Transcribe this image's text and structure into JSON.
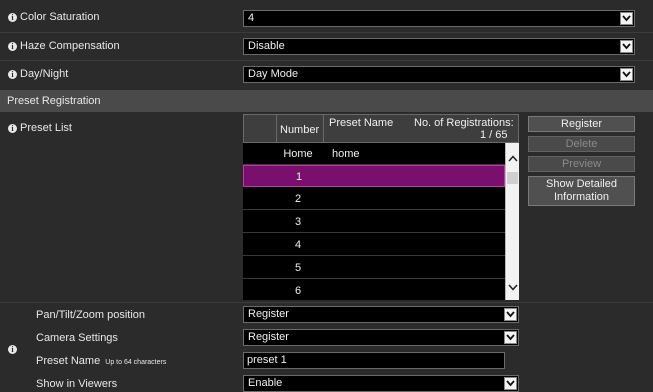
{
  "settings": {
    "color_saturation": {
      "label": "Color Saturation",
      "value": "4"
    },
    "haze_compensation": {
      "label": "Haze Compensation",
      "value": "Disable"
    },
    "day_night": {
      "label": "Day/Night",
      "value": "Day Mode"
    }
  },
  "section_title": "Preset Registration",
  "preset_list": {
    "label": "Preset List",
    "columns": {
      "number": "Number",
      "preset_name": "Preset Name",
      "registrations": "No. of Registrations:",
      "registrations_count": "1 / 65"
    },
    "rows": [
      {
        "number": "Home",
        "name": "home",
        "selected": false
      },
      {
        "number": "1",
        "name": "",
        "selected": true
      },
      {
        "number": "2",
        "name": "",
        "selected": false
      },
      {
        "number": "3",
        "name": "",
        "selected": false
      },
      {
        "number": "4",
        "name": "",
        "selected": false
      },
      {
        "number": "5",
        "name": "",
        "selected": false
      },
      {
        "number": "6",
        "name": "",
        "selected": false
      }
    ],
    "buttons": {
      "register": "Register",
      "delete": "Delete",
      "preview": "Preview",
      "show_detailed_line1": "Show Detailed",
      "show_detailed_line2": "Information"
    }
  },
  "preset_options": {
    "ptz_position": {
      "label": "Pan/Tilt/Zoom position",
      "value": "Register"
    },
    "camera_settings": {
      "label": "Camera Settings",
      "value": "Register"
    },
    "preset_name": {
      "label": "Preset Name",
      "hint": "Up to 64 characters",
      "value": "preset 1"
    },
    "show_in_viewers": {
      "label": "Show in Viewers",
      "value": "Enable"
    }
  },
  "colors": {
    "accent_selected_row": "#7a0f6e",
    "section_bar": "#4a4a4a"
  },
  "icons": [
    "info-icon",
    "chevron-down-icon",
    "chevron-up-icon"
  ]
}
